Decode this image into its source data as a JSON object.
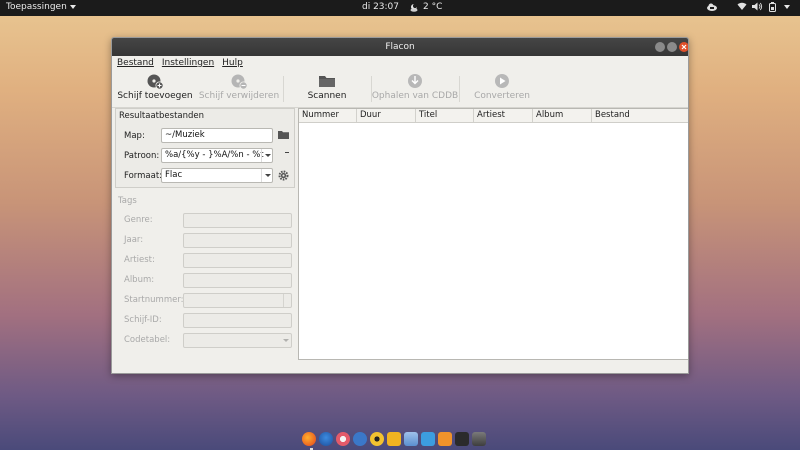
{
  "topbar": {
    "apps_menu": "Toepassingen",
    "clock": "di 23:07",
    "weather": "2 °C"
  },
  "window": {
    "title": "Flacon",
    "menu": [
      "Bestand",
      "Instellingen",
      "Hulp"
    ],
    "toolbar": {
      "add_disc": "Schijf toevoegen",
      "remove_disc": "Schijf verwijderen",
      "scan": "Scannen",
      "cddb": "Ophalen van CDDB",
      "convert": "Converteren"
    },
    "results": {
      "title": "Resultaatbestanden",
      "folder_label": "Map:",
      "folder_value": "~/Muziek",
      "pattern_label": "Patroon:",
      "pattern_value": "%a/{%y - }%A/%n - %t",
      "format_label": "Formaat:",
      "format_value": "Flac"
    },
    "tags": {
      "title": "Tags",
      "genre": "Genre:",
      "year": "Jaar:",
      "artist": "Artiest:",
      "album": "Album:",
      "start_number": "Startnummer:",
      "disc_id": "Schijf-ID:",
      "codepage": "Codetabel:"
    },
    "table": {
      "columns": [
        "Nummer",
        "Duur",
        "Titel",
        "Artiest",
        "Album",
        "Bestand"
      ]
    }
  },
  "colors": {
    "titlebar": "#3b3b3b",
    "close": "#e0502a",
    "window_bg": "#f0efeb"
  }
}
